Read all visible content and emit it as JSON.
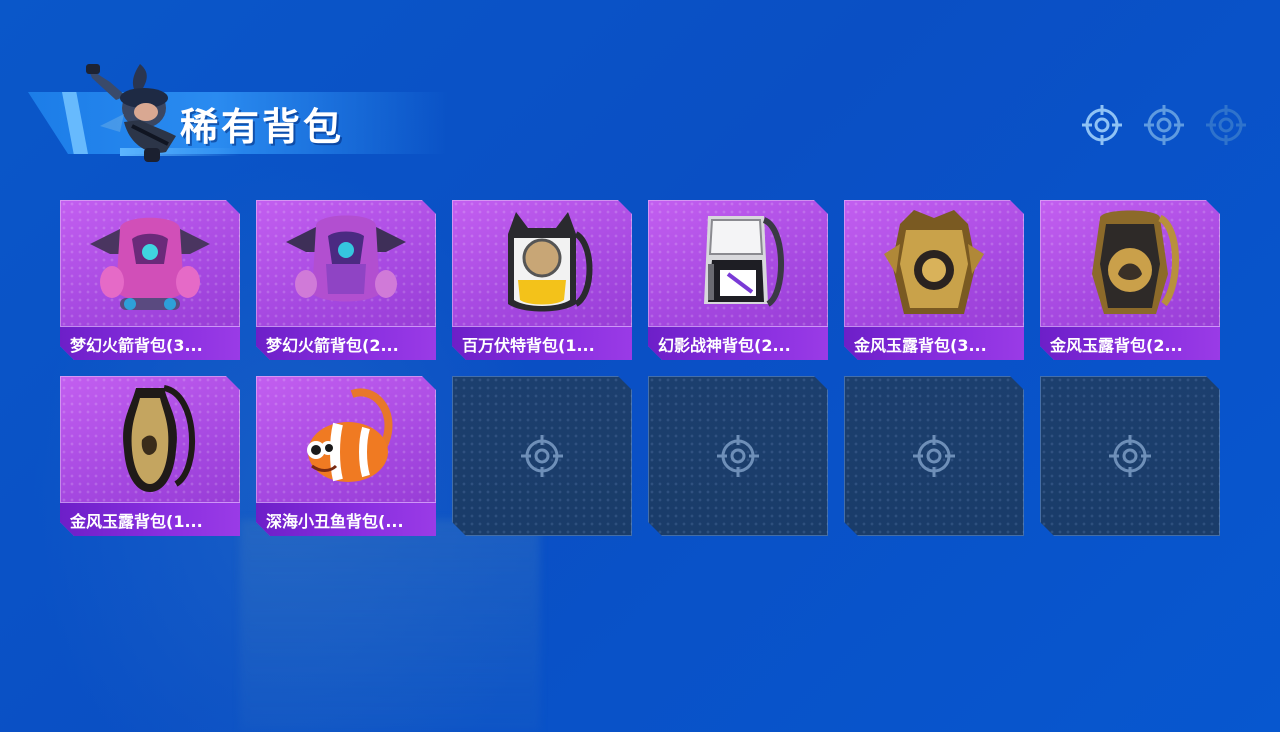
{
  "header": {
    "title": "稀有背包"
  },
  "top_icons": [
    "crosshair-icon",
    "crosshair-icon",
    "crosshair-icon"
  ],
  "items": [
    {
      "label": "梦幻火箭背包(3...",
      "kind": "rocket-pink-backpack"
    },
    {
      "label": "梦幻火箭背包(2...",
      "kind": "rocket-purple-backpack"
    },
    {
      "label": "百万伏特背包(1...",
      "kind": "cat-backpack"
    },
    {
      "label": "幻影战神背包(2...",
      "kind": "phantom-backpack"
    },
    {
      "label": "金风玉露背包(3...",
      "kind": "gold-dragon-backpack"
    },
    {
      "label": "金风玉露背包(2...",
      "kind": "gold-lotus-backpack"
    },
    {
      "label": "金风玉露背包(1...",
      "kind": "gold-vase-backpack"
    },
    {
      "label": "深海小丑鱼背包(...",
      "kind": "clownfish-backpack"
    }
  ],
  "empty_slots": 4,
  "colors": {
    "background": "#0a57c9",
    "card_purple": "#a548e0",
    "label_purple": "#7a28d6",
    "empty_slot": "#1c3f6e"
  }
}
